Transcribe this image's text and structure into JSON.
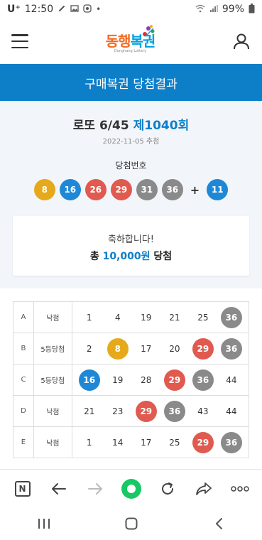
{
  "status_bar": {
    "carrier": "U⁺",
    "time": "12:50",
    "battery": "99%",
    "icons": [
      "link-icon",
      "image-icon",
      "app-icon",
      "dot-icon",
      "wifi-icon",
      "signal-icon",
      "battery-icon"
    ]
  },
  "header": {
    "logo_text_1": "동행",
    "logo_text_2": "복권",
    "logo_sub": "Donghang Lottery",
    "menu_icon": "hamburger-menu-icon",
    "user_icon": "user-icon"
  },
  "title_bar": {
    "title": "구매복권 당첨결과"
  },
  "draw": {
    "game": "로또 6/45",
    "round": "제1040회",
    "date": "2022-11-05 추첨",
    "win_label": "당첨번호",
    "numbers": [
      {
        "n": "8",
        "color": "#e5a91b"
      },
      {
        "n": "16",
        "color": "#1e88d6"
      },
      {
        "n": "26",
        "color": "#e05a4f"
      },
      {
        "n": "29",
        "color": "#e05a4f"
      },
      {
        "n": "31",
        "color": "#8a8a8a"
      },
      {
        "n": "36",
        "color": "#8a8a8a"
      }
    ],
    "plus": "+",
    "bonus": {
      "n": "11",
      "color": "#1e88d6"
    }
  },
  "congrats": {
    "message": "축하합니다!",
    "prefix": "총",
    "amount": "10,000원",
    "suffix": "당첨"
  },
  "ticket": {
    "rows": [
      {
        "game": "A",
        "rank": "낙첨",
        "nums": [
          {
            "n": "1",
            "hit": false
          },
          {
            "n": "4",
            "hit": false
          },
          {
            "n": "19",
            "hit": false
          },
          {
            "n": "21",
            "hit": false
          },
          {
            "n": "25",
            "hit": false
          },
          {
            "n": "36",
            "hit": true,
            "color": "#8a8a8a"
          }
        ]
      },
      {
        "game": "B",
        "rank": "5등당첨",
        "nums": [
          {
            "n": "2",
            "hit": false
          },
          {
            "n": "8",
            "hit": true,
            "color": "#e5a91b"
          },
          {
            "n": "17",
            "hit": false
          },
          {
            "n": "20",
            "hit": false
          },
          {
            "n": "29",
            "hit": true,
            "color": "#e05a4f"
          },
          {
            "n": "36",
            "hit": true,
            "color": "#8a8a8a"
          }
        ]
      },
      {
        "game": "C",
        "rank": "5등당첨",
        "nums": [
          {
            "n": "16",
            "hit": true,
            "color": "#1e88d6"
          },
          {
            "n": "19",
            "hit": false
          },
          {
            "n": "28",
            "hit": false
          },
          {
            "n": "29",
            "hit": true,
            "color": "#e05a4f"
          },
          {
            "n": "36",
            "hit": true,
            "color": "#8a8a8a"
          },
          {
            "n": "44",
            "hit": false
          }
        ]
      },
      {
        "game": "D",
        "rank": "낙첨",
        "nums": [
          {
            "n": "21",
            "hit": false
          },
          {
            "n": "23",
            "hit": false
          },
          {
            "n": "29",
            "hit": true,
            "color": "#e05a4f"
          },
          {
            "n": "36",
            "hit": true,
            "color": "#8a8a8a"
          },
          {
            "n": "43",
            "hit": false
          },
          {
            "n": "44",
            "hit": false
          }
        ]
      },
      {
        "game": "E",
        "rank": "낙첨",
        "nums": [
          {
            "n": "1",
            "hit": false
          },
          {
            "n": "14",
            "hit": false
          },
          {
            "n": "17",
            "hit": false
          },
          {
            "n": "25",
            "hit": false
          },
          {
            "n": "29",
            "hit": true,
            "color": "#e05a4f"
          },
          {
            "n": "36",
            "hit": true,
            "color": "#8a8a8a"
          }
        ]
      }
    ]
  },
  "browser_toolbar": {
    "icons": [
      "naver-n-icon",
      "back-arrow-icon",
      "forward-arrow-icon",
      "home-dot-icon",
      "refresh-icon",
      "share-icon",
      "more-dots-icon"
    ]
  },
  "nav_bar": {
    "icons": [
      "recent-apps-icon",
      "home-icon",
      "back-icon"
    ]
  }
}
